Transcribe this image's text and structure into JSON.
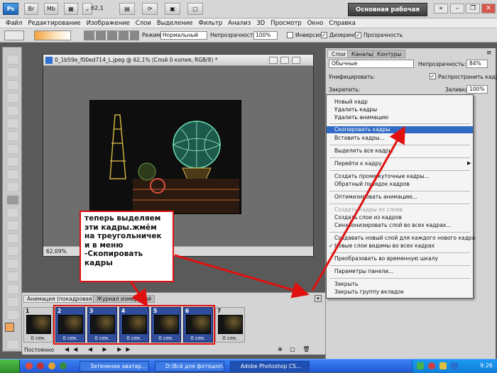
{
  "appbar": {
    "zoom": "62,1",
    "workspace": "Основная рабочая среда",
    "ps_logo": "Ps"
  },
  "menubar": {
    "items": [
      "Файл",
      "Редактирование",
      "Изображение",
      "Слои",
      "Выделение",
      "Фильтр",
      "Анализ",
      "3D",
      "Просмотр",
      "Окно",
      "Справка"
    ]
  },
  "options": {
    "mode_label": "Режим:",
    "mode_value": "Нормальный",
    "opacity_label": "Непрозрачность:",
    "opacity_value": "100%",
    "invert_label": "Инверсия",
    "dither_label": "Дизеринг",
    "transparency_label": "Прозрачность"
  },
  "document": {
    "title": "0_1b59e_f00ed714_L.jpeg @ 62,1% (Слой 0 копия, RGB/8) *",
    "zoom_status": "62,09%"
  },
  "layers_panel": {
    "tabs": [
      "Слои",
      "Каналы",
      "Контуры"
    ],
    "blend_mode": "Обычные",
    "opacity_label": "Непрозрачность:",
    "opacity_value": "84%",
    "unify_label": "Унифицировать:",
    "propagate_label": "Распространить кадр 1",
    "lock_label": "Закрепить:",
    "fill_label": "Заливка:",
    "fill_value": "100%"
  },
  "context_menu": {
    "items": [
      {
        "label": "Новый кадр",
        "state": "normal"
      },
      {
        "label": "Удалить кадры",
        "state": "normal"
      },
      {
        "label": "Удалить анимацию",
        "state": "normal"
      },
      {
        "label": "Скопировать кадры",
        "state": "highlighted"
      },
      {
        "label": "Вставить кадры...",
        "state": "normal"
      },
      {
        "label": "Выделить все кадры",
        "state": "normal"
      },
      {
        "label": "Перейти к кадру",
        "state": "submenu"
      },
      {
        "label": "Создать промежуточные кадры...",
        "state": "normal"
      },
      {
        "label": "Обратный порядок кадров",
        "state": "normal"
      },
      {
        "label": "Оптимизировать анимацию...",
        "state": "normal"
      },
      {
        "label": "Создать кадры из слоев",
        "state": "disabled"
      },
      {
        "label": "Создать слои из кадров",
        "state": "normal"
      },
      {
        "label": "Синхронизировать слой во всех кадрах...",
        "state": "normal"
      },
      {
        "label": "Создавать новый слой для каждого нового кадра",
        "state": "normal"
      },
      {
        "label": "Новые слои видимы во всех кадрах",
        "state": "checked"
      },
      {
        "label": "Преобразовать во временную шкалу",
        "state": "normal"
      },
      {
        "label": "Параметры панели...",
        "state": "normal"
      },
      {
        "label": "Закрыть",
        "state": "normal"
      },
      {
        "label": "Закрыть группу вкладок",
        "state": "normal"
      }
    ]
  },
  "animation": {
    "tab1": "Анимация (покадровая)",
    "tab2": "Журнал измерений",
    "loop": "Постоянно",
    "frames": [
      {
        "num": "1",
        "delay": "0 сек.",
        "selected": false
      },
      {
        "num": "2",
        "delay": "0 сек.",
        "selected": true
      },
      {
        "num": "3",
        "delay": "0 сек.",
        "selected": true
      },
      {
        "num": "4",
        "delay": "0 сек.",
        "selected": true
      },
      {
        "num": "5",
        "delay": "0 сек.",
        "selected": true
      },
      {
        "num": "6",
        "delay": "0 сек.",
        "selected": true
      },
      {
        "num": "7",
        "delay": "0 сек.",
        "selected": false
      }
    ]
  },
  "annotation": {
    "text": "теперь выделяем эти кадры.жмём на треугольничек и в меню\n-Скопировать кадры"
  },
  "taskbar": {
    "buttons": [
      "Затенение аватар...",
      "D:\\Всё для фотошоп...",
      "Adobe Photoshop CS..."
    ],
    "time": "9:26"
  },
  "colors": {
    "accent": "#316ac5",
    "annotation_border": "#e01010",
    "selected_frame": "#2f4d9a",
    "foreground": "#f2a65a",
    "background": "#ffffff"
  }
}
